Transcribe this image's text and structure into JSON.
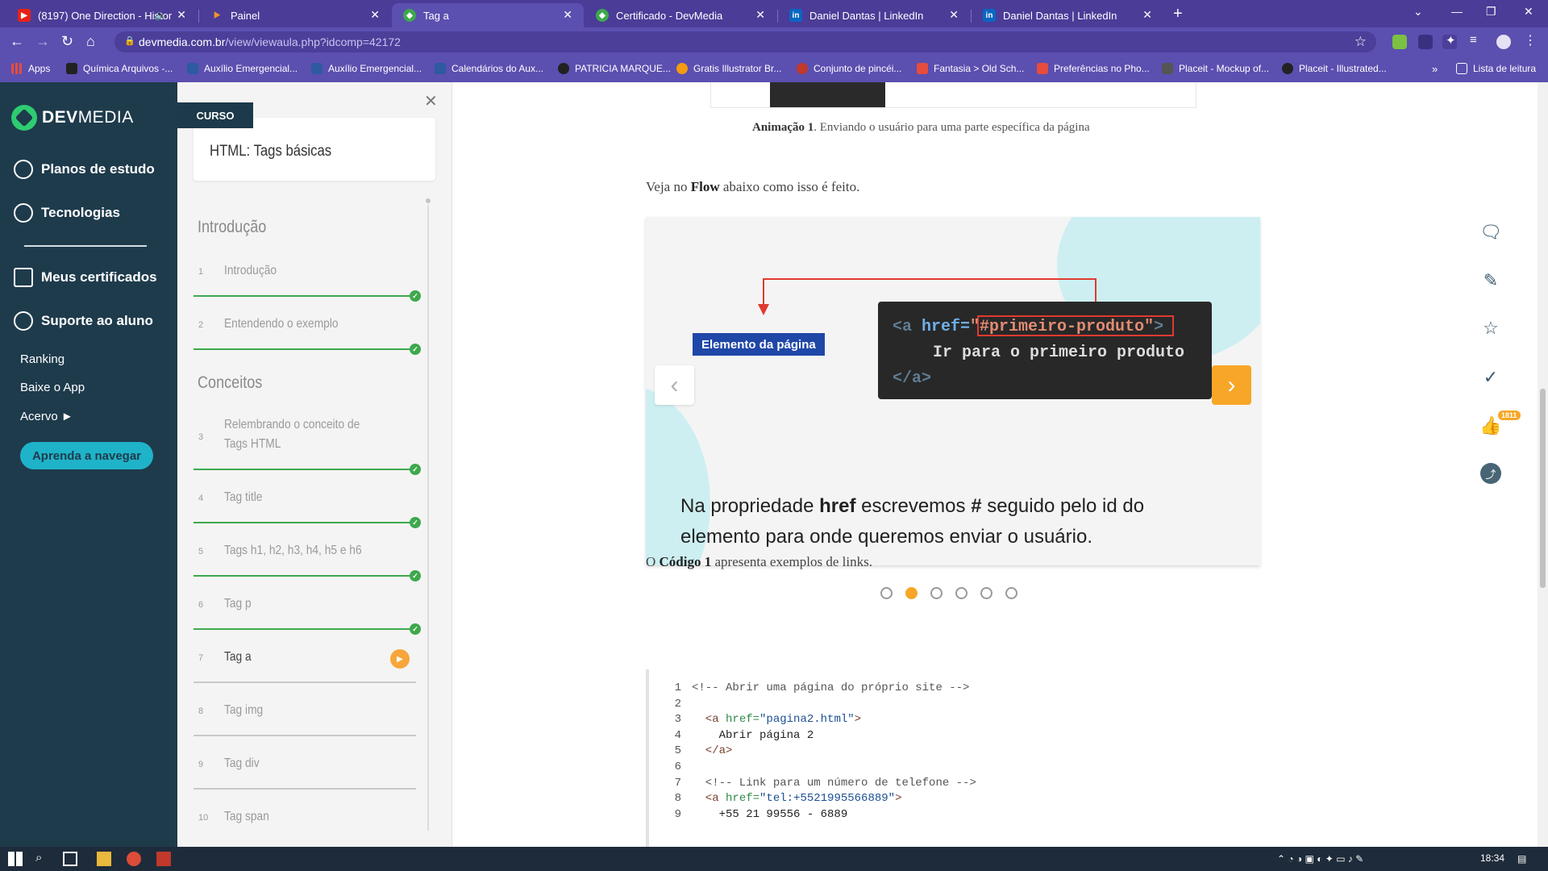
{
  "browser": {
    "tabs": [
      {
        "title": "(8197) One Direction - Histor",
        "favicon": "youtube-icon",
        "color": "#e62117",
        "muted": true
      },
      {
        "title": "Painel",
        "favicon": "painel-icon",
        "color": "#f0932b"
      },
      {
        "title": "Tag a",
        "favicon": "devmedia-icon",
        "color": "#3ea84d",
        "active": true
      },
      {
        "title": "Certificado - DevMedia",
        "favicon": "devmedia-icon",
        "color": "#3ea84d"
      },
      {
        "title": "Daniel Dantas | LinkedIn",
        "favicon": "linkedin-icon",
        "color": "#0a66c2"
      },
      {
        "title": "Daniel Dantas | LinkedIn",
        "favicon": "linkedin-icon",
        "color": "#0a66c2"
      }
    ],
    "url_host": "devmedia.com.br",
    "url_path": "/view/viewaula.php?idcomp=42172",
    "bookmarks": [
      {
        "label": "Apps",
        "color": "#e74c3c"
      },
      {
        "label": "Química Arquivos -...",
        "color": "#222222"
      },
      {
        "label": "Auxílio Emergencial...",
        "color": "#2d5aa0"
      },
      {
        "label": "Auxílio Emergencial...",
        "color": "#2d5aa0"
      },
      {
        "label": "Calendários do Aux...",
        "color": "#2d5aa0"
      },
      {
        "label": "PATRICIA MARQUE...",
        "color": "#222222"
      },
      {
        "label": "Gratis Illustrator Br...",
        "color": "#f39c12"
      },
      {
        "label": "Conjunto de pincéi...",
        "color": "#c0392b"
      },
      {
        "label": "Fantasia > Old Sch...",
        "color": "#e74c3c"
      },
      {
        "label": "Preferências no Pho...",
        "color": "#e74c3c"
      },
      {
        "label": "Placeit - Mockup of...",
        "color": "#555555"
      },
      {
        "label": "Placeit - Illustrated...",
        "color": "#222222"
      }
    ],
    "reading_list": "Lista de leitura"
  },
  "nav": {
    "brand_bold": "DEV",
    "brand_rest": "MEDIA",
    "items": [
      {
        "label": "Planos de estudo",
        "icon": "chart-icon"
      },
      {
        "label": "Tecnologias",
        "icon": "compass-icon"
      },
      {
        "label": "Meus certificados",
        "icon": "certificate-icon"
      },
      {
        "label": "Suporte ao aluno",
        "icon": "help-icon"
      }
    ],
    "sub_items": [
      "Ranking",
      "Baixe o App",
      "Acervo ►"
    ],
    "learn_button": "Aprenda a navegar"
  },
  "course": {
    "tag": "CURSO",
    "title": "HTML: Tags básicas",
    "sections": [
      "Introdução",
      "Conceitos"
    ],
    "lessons": [
      {
        "num": "1",
        "title": "Introdução",
        "status": "done"
      },
      {
        "num": "2",
        "title": "Entendendo o exemplo",
        "status": "done"
      },
      {
        "num": "3",
        "title": "Relembrando o conceito de",
        "title2": "Tags HTML",
        "status": "done"
      },
      {
        "num": "4",
        "title": "Tag title",
        "status": "done"
      },
      {
        "num": "5",
        "title": "Tags h1, h2, h3, h4, h5 e h6",
        "status": "done"
      },
      {
        "num": "6",
        "title": "Tag p",
        "status": "done"
      },
      {
        "num": "7",
        "title": "Tag a",
        "status": "current"
      },
      {
        "num": "8",
        "title": "Tag img",
        "status": "pending"
      },
      {
        "num": "9",
        "title": "Tag div",
        "status": "pending"
      },
      {
        "num": "10",
        "title": "Tag span",
        "status": "pending"
      }
    ]
  },
  "content": {
    "caption_bold": "Animação 1",
    "caption_rest": ". Enviando o usuário para uma parte específica da página",
    "intro_pre": "Veja no ",
    "intro_bold": "Flow",
    "intro_post": " abaixo como isso é feito.",
    "slide": {
      "label": "Elemento da página",
      "code_line1_tag": "<a ",
      "code_line1_attr": "href=",
      "code_line1_val": "\"#primeiro-produto\"",
      "code_line1_close": ">",
      "code_line2": "Ir para o primeiro produto",
      "code_line3": "</a>",
      "text_1": "Na propriedade ",
      "text_b1": "href",
      "text_2": " escrevemos ",
      "text_b2": "#",
      "text_3": " seguido pelo id do elemento para onde queremos enviar o usuário.",
      "slide_count": 6,
      "active_slide": 2
    },
    "code_intro_pre": "O ",
    "code_intro_bold": "Código 1",
    "code_intro_post": " apresenta exemplos de links.",
    "code_lines": [
      {
        "n": "1",
        "parts": [
          {
            "c": "cmt",
            "t": "<!-- Abrir uma página do próprio site -->"
          }
        ]
      },
      {
        "n": "2",
        "parts": []
      },
      {
        "n": "3",
        "parts": [
          {
            "c": "tg",
            "t": "  <a "
          },
          {
            "c": "at",
            "t": "href="
          },
          {
            "c": "sv",
            "t": "\"pagina2.html\""
          },
          {
            "c": "tg",
            "t": ">"
          }
        ]
      },
      {
        "n": "4",
        "parts": [
          {
            "c": "tx",
            "t": "    Abrir página 2"
          }
        ]
      },
      {
        "n": "5",
        "parts": [
          {
            "c": "tg",
            "t": "  </a>"
          }
        ]
      },
      {
        "n": "6",
        "parts": []
      },
      {
        "n": "7",
        "parts": [
          {
            "c": "cmt",
            "t": "  <!-- Link para um número de telefone -->"
          }
        ]
      },
      {
        "n": "8",
        "parts": [
          {
            "c": "tg",
            "t": "  <a "
          },
          {
            "c": "at",
            "t": "href="
          },
          {
            "c": "sv",
            "t": "\"tel:+5521995566889\""
          },
          {
            "c": "tg",
            "t": ">"
          }
        ]
      },
      {
        "n": "9",
        "parts": [
          {
            "c": "tx",
            "t": "    +55 21 99556 - 6889"
          }
        ]
      }
    ],
    "like_count": "1811"
  },
  "taskbar": {
    "time": "18:34"
  }
}
